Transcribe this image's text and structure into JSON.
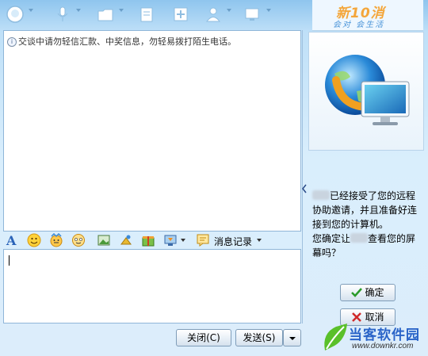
{
  "logo": {
    "main": "新10消",
    "sub": "会对 会生活"
  },
  "chat": {
    "notice": "交谈中请勿轻信汇款、中奖信息，勿轻易拨打陌生电话。"
  },
  "format_bar": {
    "history_label": "消息记录"
  },
  "buttons": {
    "close": "关闭(C)",
    "send": "发送(S)"
  },
  "remote": {
    "line1": "已经接受了您的远程",
    "line2": "协助邀请，并且准备好连",
    "line3": "接到您的计算机。",
    "line4_a": "您确定让",
    "line4_b": "查看您的屏",
    "line5": "幕吗？",
    "confirm": "确定",
    "cancel": "取消"
  },
  "watermark": {
    "title": "当客软件园",
    "url": "www.downkr.com"
  },
  "icons": {
    "toolbar": [
      "qq-avatar-icon",
      "microphone-icon",
      "folder-icon",
      "document-icon",
      "add-contact-icon",
      "profile-icon",
      "remote-assist-icon"
    ],
    "format": [
      "font-icon",
      "smiley-icon",
      "emoji-face-icon",
      "sticker-icon",
      "image-icon",
      "screenshot-icon",
      "gift-icon",
      "screen-share-icon",
      "history-icon"
    ]
  },
  "colors": {
    "accent": "#2a64c8",
    "window_bg": "#cfe6f8",
    "logo_orange": "#f4a63a"
  }
}
